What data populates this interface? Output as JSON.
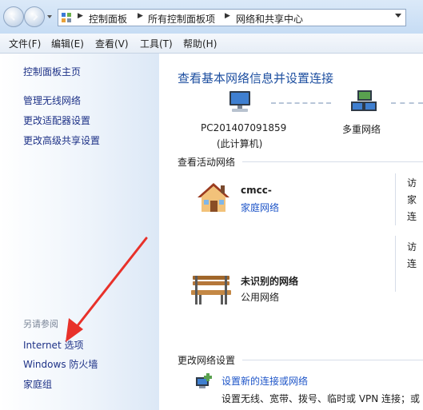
{
  "breadcrumb": [
    "控制面板",
    "所有控制面板项",
    "网络和共享中心"
  ],
  "menu": [
    "文件(F)",
    "编辑(E)",
    "查看(V)",
    "工具(T)",
    "帮助(H)"
  ],
  "sidebar": {
    "links": [
      "控制面板主页",
      "管理无线网络",
      "更改适配器设置",
      "更改高级共享设置"
    ],
    "see_also_header": "另请参阅",
    "see_also": [
      "Internet 选项",
      "Windows 防火墙",
      "家庭组"
    ]
  },
  "main": {
    "title": "查看基本网络信息并设置连接",
    "computer_name": "PC201407091859",
    "computer_sub": "(此计算机)",
    "multi_network": "多重网络",
    "active_header": "查看活动网络",
    "networks": [
      {
        "name": "cmcc-",
        "type": "家庭网络",
        "type_is_link": true,
        "right_partial": [
          "访",
          "家",
          "连"
        ]
      },
      {
        "name": "未识别的网络",
        "type": "公用网络",
        "type_is_link": false,
        "right_partial": [
          "访",
          "连"
        ]
      }
    ],
    "change_header": "更改网络设置",
    "setup_link": "设置新的连接或网络",
    "setup_desc": "设置无线、宽带、拨号、临时或 VPN 连接；或"
  },
  "colors": {
    "accent": "#1e55c8",
    "title": "#1e4fa0",
    "arrow": "#e8312a"
  }
}
